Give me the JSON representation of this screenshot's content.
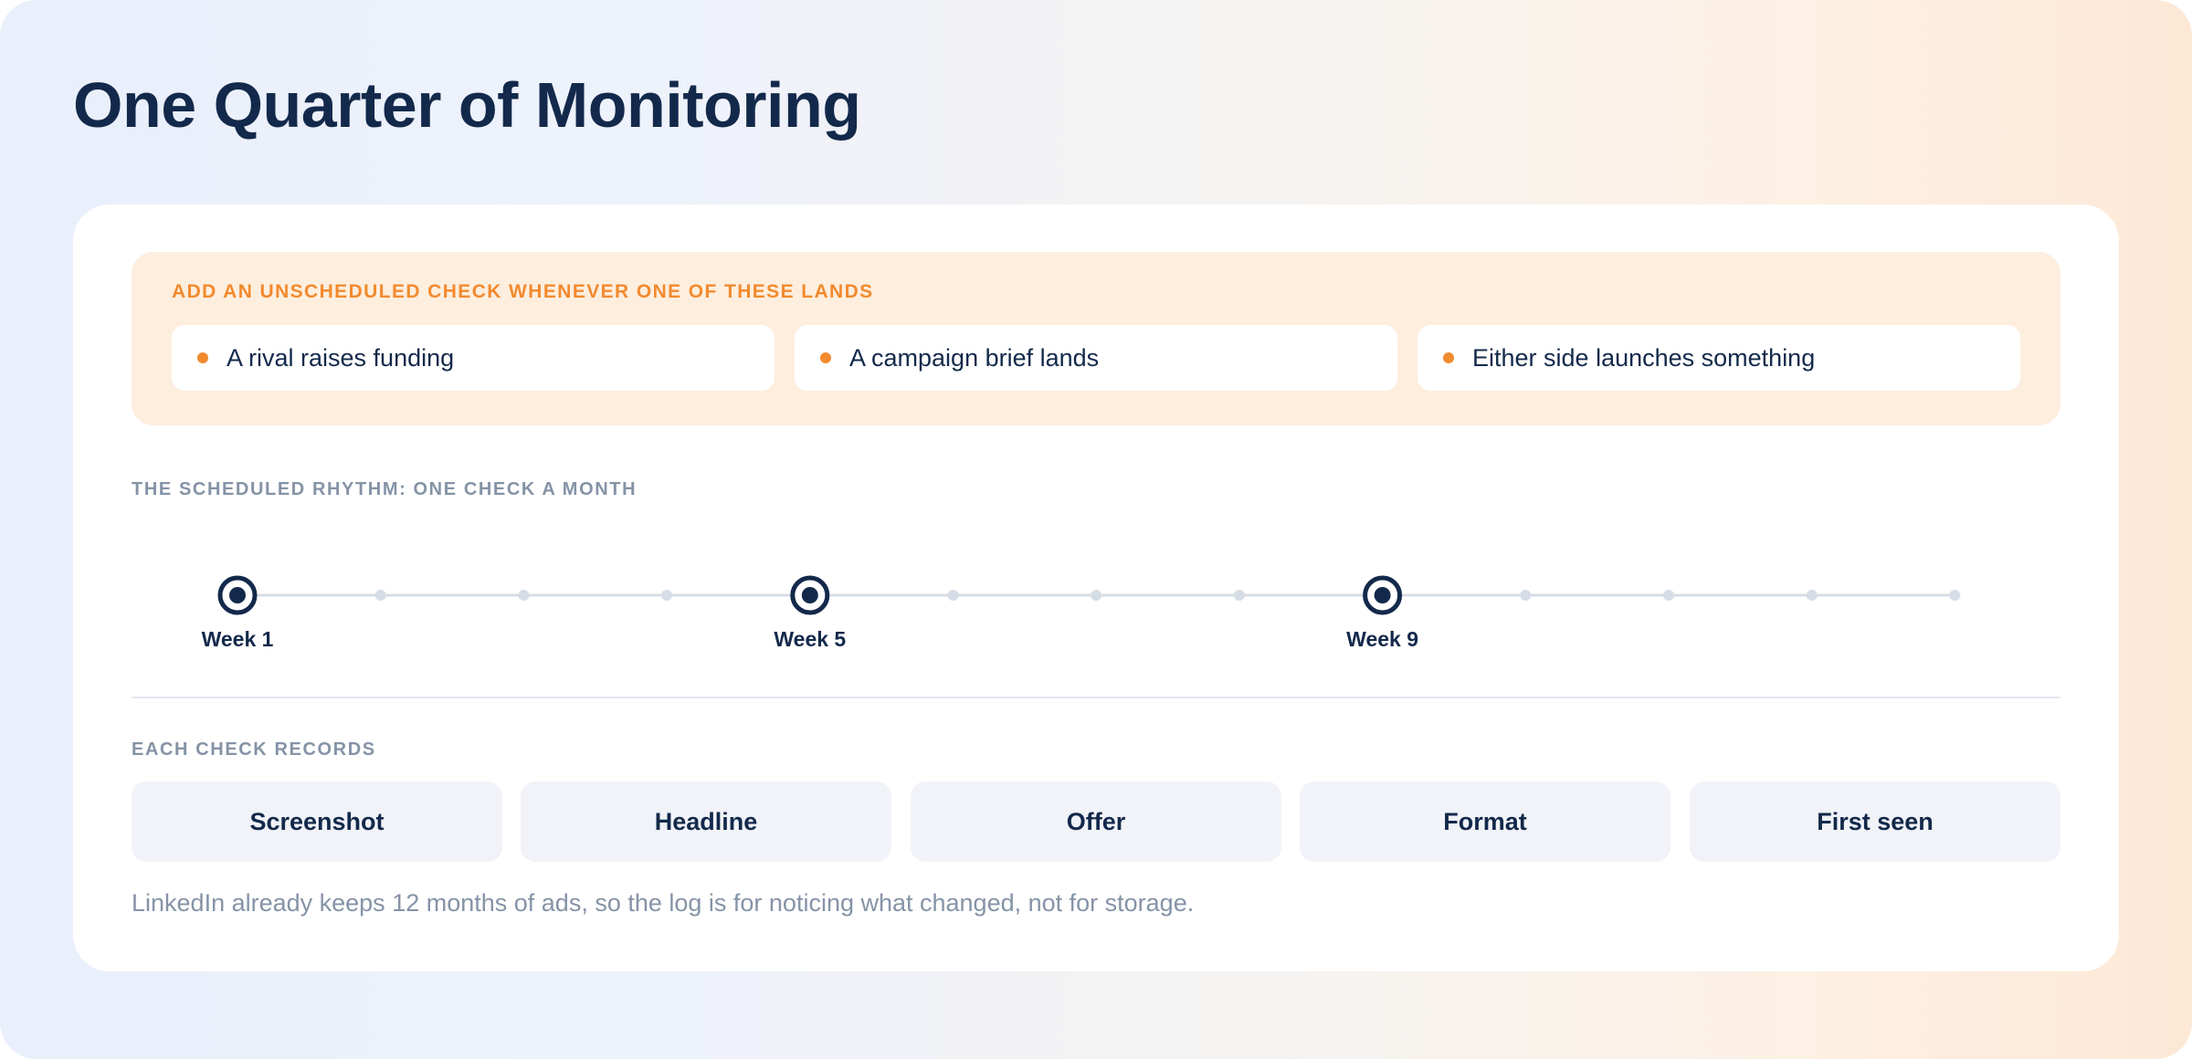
{
  "page": {
    "title": "One Quarter of Monitoring"
  },
  "triggers": {
    "heading": "ADD AN UNSCHEDULED CHECK WHENEVER ONE OF THESE LANDS",
    "items": [
      {
        "label": "A rival raises funding"
      },
      {
        "label": "A campaign brief lands"
      },
      {
        "label": "Either side launches something"
      }
    ],
    "accent_color": "#f28a2e"
  },
  "rhythm": {
    "heading": "THE SCHEDULED RHYTHM: ONE CHECK A MONTH",
    "total_weeks": 13,
    "checks": [
      {
        "week": 1,
        "label": "Week 1"
      },
      {
        "week": 5,
        "label": "Week 5"
      },
      {
        "week": 9,
        "label": "Week 9"
      }
    ],
    "primary_color": "#13294b",
    "track_color": "#d6dde6"
  },
  "records": {
    "heading": "EACH CHECK RECORDS",
    "fields": [
      {
        "label": "Screenshot"
      },
      {
        "label": "Headline"
      },
      {
        "label": "Offer"
      },
      {
        "label": "Format"
      },
      {
        "label": "First seen"
      }
    ]
  },
  "footnote": "LinkedIn already keeps 12 months of ads, so the log is for noticing what changed, not for storage."
}
